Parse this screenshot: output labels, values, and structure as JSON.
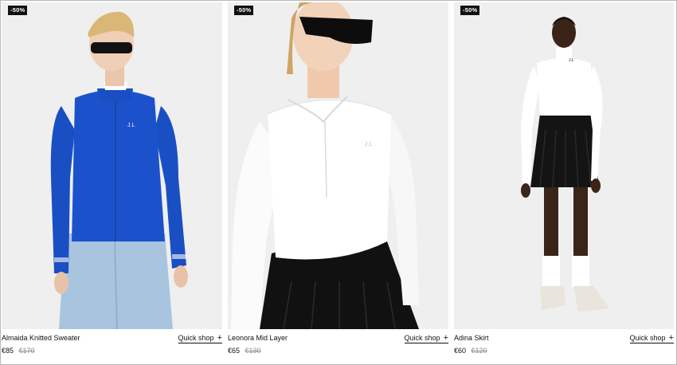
{
  "products": [
    {
      "badge": "-50%",
      "name": "Almaida Knitted Sweater",
      "price": "€85",
      "original_price": "€170",
      "quick_shop": "Quick shop",
      "quick_shop_icon": "plus-icon"
    },
    {
      "badge": "-50%",
      "name": "Leonora Mid Layer",
      "price": "€65",
      "original_price": "€130",
      "quick_shop": "Quick shop",
      "quick_shop_icon": "plus-icon"
    },
    {
      "badge": "-50%",
      "name": "Adina Skirt",
      "price": "€60",
      "original_price": "€120",
      "quick_shop": "Quick shop",
      "quick_shop_icon": "plus-icon"
    }
  ],
  "plus_glyph": "+",
  "colors": {
    "badge_bg": "#111111",
    "sweater_blue": "#1a4fc4",
    "photo_bg": "#f0f0f0",
    "strike_grey": "#8a8a8a"
  }
}
